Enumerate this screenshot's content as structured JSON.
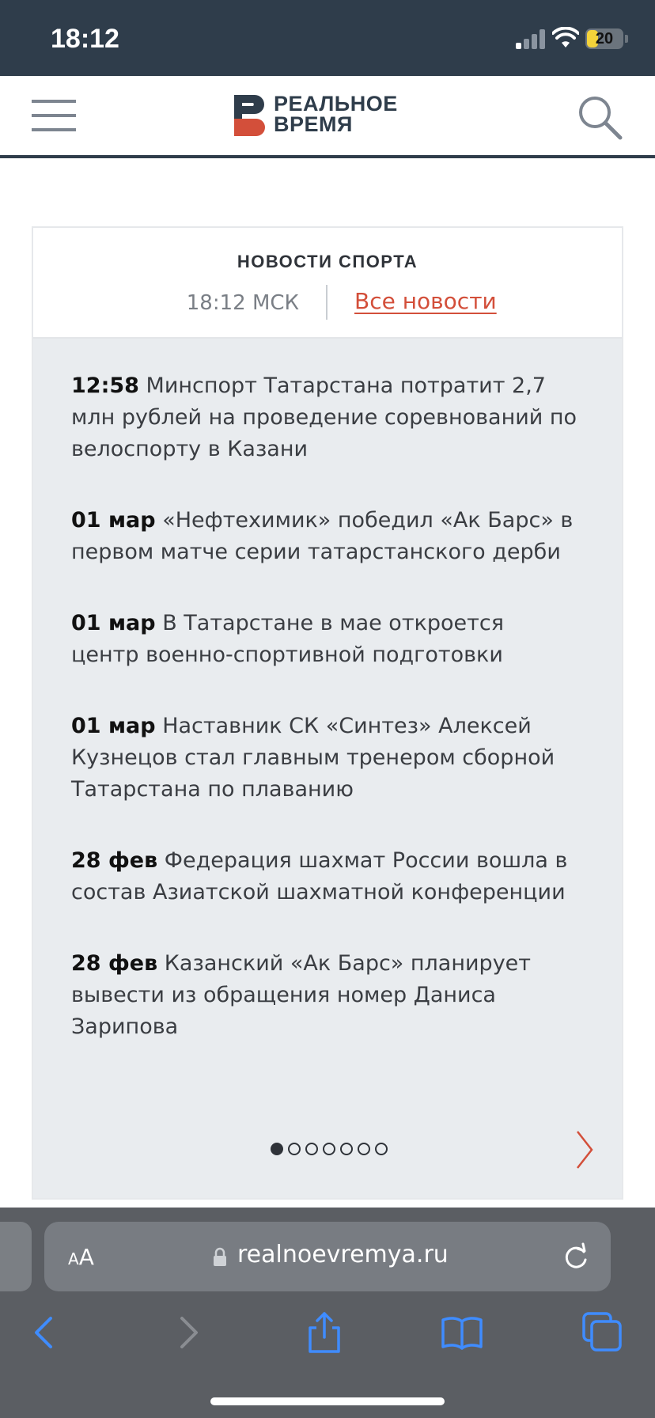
{
  "status_bar": {
    "time": "18:12",
    "battery": "20"
  },
  "header": {
    "logo_line1": "РЕАЛЬНОЕ",
    "logo_line2": "ВРЕМЯ",
    "menu_icon": "hamburger-icon",
    "search_icon": "search-icon"
  },
  "news_widget": {
    "title": "НОВОСТИ СПОРТА",
    "current_time": "18:12 МСК",
    "all_news_link": "Все новости",
    "items": [
      {
        "date": "12:58",
        "text": "Минспорт Татарстана потратит 2,7 млн рублей на проведение соревнований по велоспорту в Казани"
      },
      {
        "date": "01 мар",
        "text": "«Нефтехимик» победил «Ак Барс» в первом матче серии татарстанского дерби"
      },
      {
        "date": "01 мар",
        "text": "В Татарстане в мае откроется центр военно-спортивной подготовки"
      },
      {
        "date": "01 мар",
        "text": "Наставник СК «Синтез» Алексей Кузнецов стал главным тренером сборной Татарстана по плаванию"
      },
      {
        "date": "28 фев",
        "text": "Федерация шахмат России вошла в состав Азиатской шахматной конференции"
      },
      {
        "date": "28 фев",
        "text": "Казанский «Ак Барс» планирует вывести из обращения номер Даниса Зарипова"
      }
    ],
    "pagination": {
      "total_pages": 7,
      "current_page": 1
    }
  },
  "browser": {
    "text_size_small": "A",
    "text_size_large": "A",
    "url": "realnoevremya.ru"
  },
  "colors": {
    "header_dark": "#2f3d4b",
    "accent_red": "#d34f3a",
    "widget_bg": "#e9ecef",
    "safari_bar": "#5b5e63",
    "safari_blue": "#3f8cff"
  }
}
